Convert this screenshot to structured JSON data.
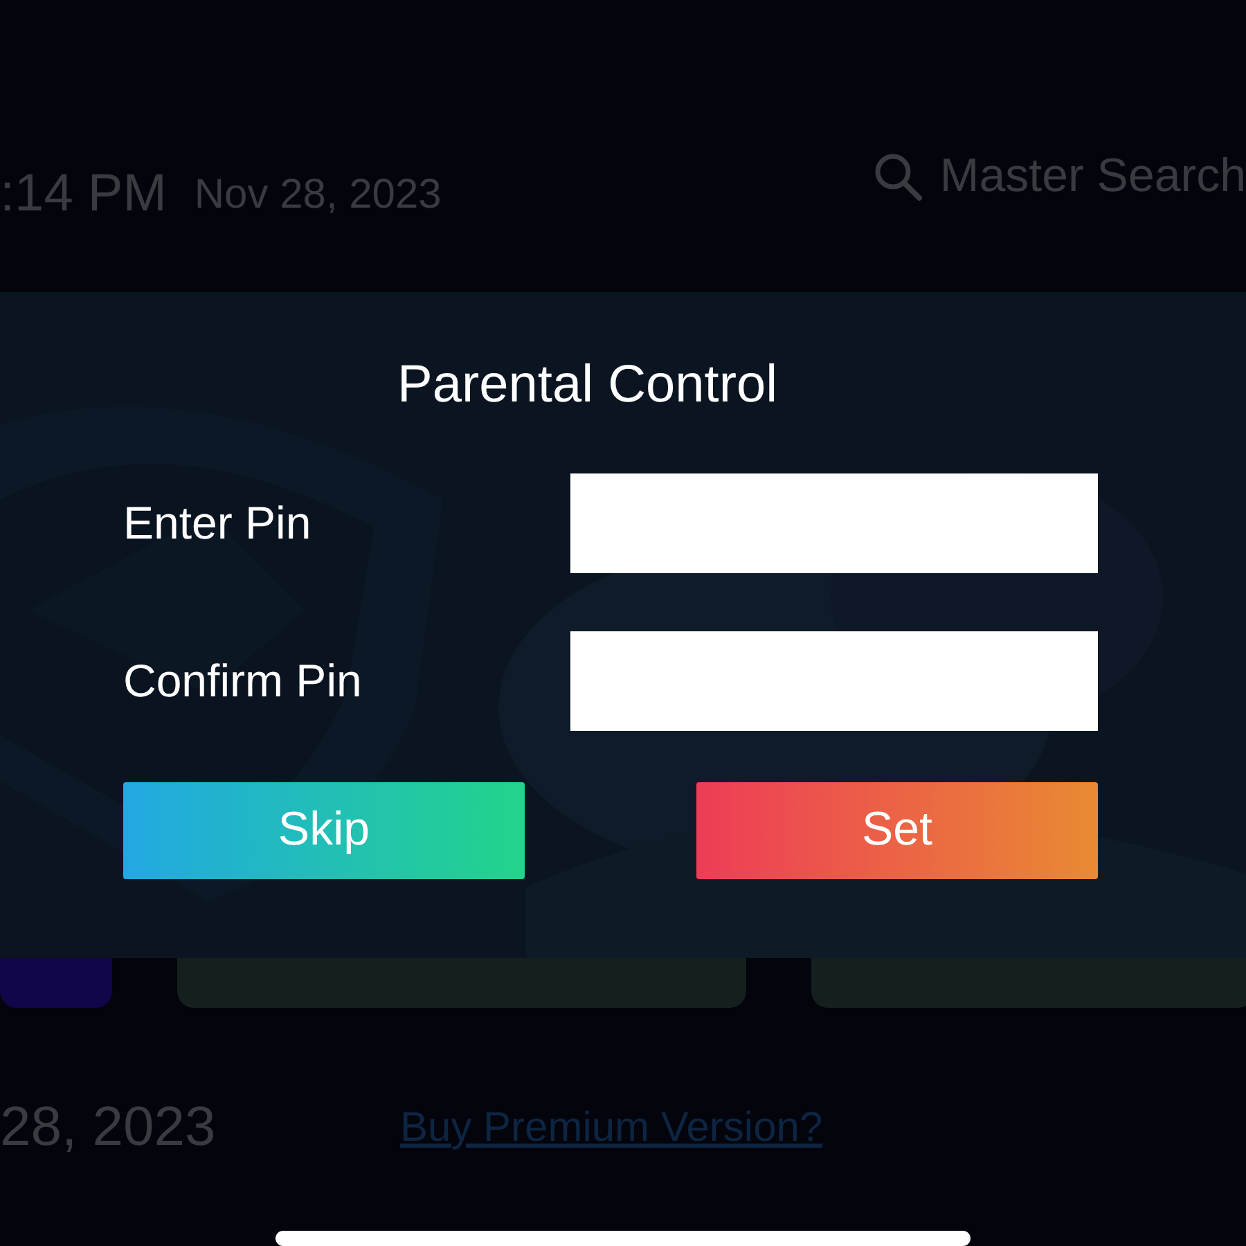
{
  "header": {
    "time": ":14 PM",
    "date": "Nov 28, 2023",
    "search": "Master Search"
  },
  "dialog": {
    "title": "Parental Control",
    "fields": [
      {
        "label": "Enter Pin"
      },
      {
        "label": "Confirm Pin"
      }
    ],
    "buttons": [
      {
        "label": "Skip",
        "kind": "skip"
      },
      {
        "label": "Set",
        "kind": "set"
      }
    ]
  },
  "footer": {
    "date": "28, 2023",
    "link": "Buy Premium Version?"
  }
}
